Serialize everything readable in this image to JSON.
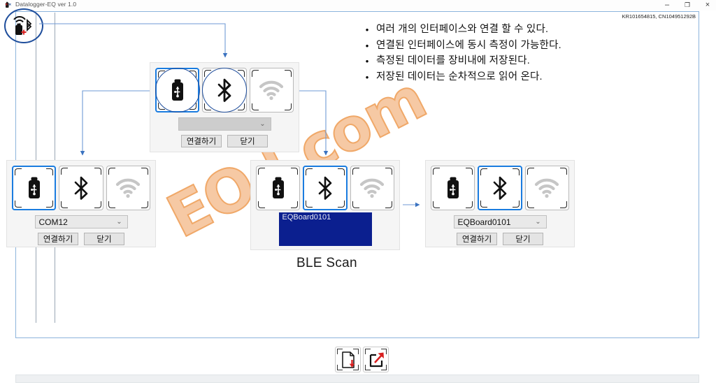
{
  "window": {
    "title": "Datalogger-EQ ver 1.0",
    "app_icon": "datalogger-icon",
    "minimize": "–",
    "maximize": "❐",
    "close": "×",
    "serial_label": "KR101654815, CN104951292B"
  },
  "bullets": [
    {
      "marker": "•",
      "text": "여러 개의 인터페이스와 연결 할 수 있다."
    },
    {
      "marker": "•",
      "text": "연결된 인터페이스에 동시 측정이 가능한다."
    },
    {
      "marker": "•",
      "text": "측정된 데이터를 장비내에 저장된다."
    },
    {
      "marker": "•",
      "text": "저장된 데이터는 순차적으로 읽어 온다."
    }
  ],
  "interfaces": {
    "usb": "usb-icon",
    "bluetooth": "bluetooth-icon",
    "wifi": "wifi-icon"
  },
  "panels": {
    "top": {
      "name": "connection-dialog-top",
      "selected": "usb",
      "ringed": [
        "usb",
        "bluetooth"
      ],
      "combo_value": "",
      "combo_arrow": "⌄",
      "connect_label": "연결하기",
      "close_label": "닫기"
    },
    "left": {
      "name": "connection-dialog-serial",
      "selected": "usb",
      "combo_value": "COM12",
      "combo_arrow": "⌄",
      "connect_label": "연결하기",
      "close_label": "닫기"
    },
    "middle": {
      "name": "connection-dialog-ble-scan",
      "selected": "bluetooth",
      "list_items": [
        "EQBoard0101"
      ],
      "caption": "BLE Scan"
    },
    "right": {
      "name": "connection-dialog-ble-selected",
      "selected": "bluetooth",
      "combo_value": "EQBoard0101",
      "combo_arrow": "⌄",
      "connect_label": "연결하기",
      "close_label": "닫기"
    }
  },
  "watermark": {
    "text": "EO    l.com"
  },
  "toolbar": {
    "import_icon": "page-download-icon",
    "export_icon": "export-arrow-icon"
  },
  "colors": {
    "accent_blue": "#1a7ce0",
    "ring_blue": "#1f4e9c",
    "connector_blue": "#5b8fd0",
    "list_blue": "#0b1f8f",
    "watermark_orange": "#f0a868",
    "arrow_red": "#d81f1f"
  }
}
